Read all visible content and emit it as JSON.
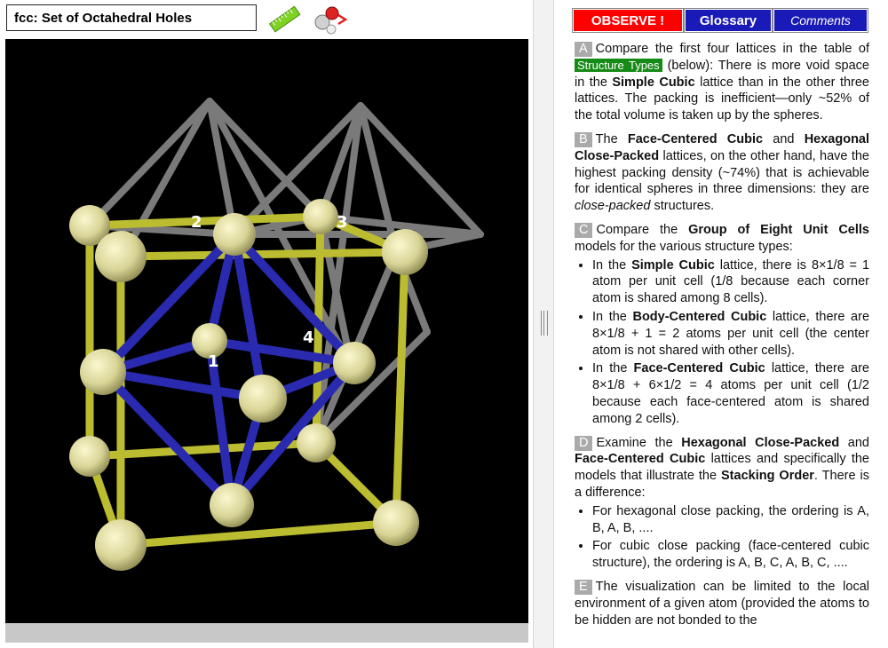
{
  "left": {
    "title": "fcc: Set of Octahedral Holes",
    "tools": {
      "ruler_icon": "ruler-icon",
      "molecule_icon": "molecule-model-icon"
    },
    "viewer": {
      "hole_labels": [
        "1",
        "2",
        "3",
        "4"
      ],
      "colors": {
        "background": "#000000",
        "cell_edges": "#c8c83a",
        "octahedron_blue": "#2a2ab4",
        "octahedron_gray": "#808080",
        "atom": "#e0dc9a"
      }
    }
  },
  "right": {
    "tabs": {
      "observe": "OBSERVE !",
      "glossary": "Glossary",
      "comments": "Comments"
    },
    "sections": {
      "A": {
        "letter": "A",
        "t1": "Compare the first four lattices in the table of",
        "link": "Structure Types",
        "t2": "(below): There is more void space in the",
        "b1": "Simple Cubic",
        "t3": "lattice than in the other three lattices. The packing is inefficient—only ~52% of the total volume is taken up by the spheres."
      },
      "B": {
        "letter": "B",
        "t1": "The",
        "b1": "Face-Centered Cubic",
        "t2": "and",
        "b2": "Hexagonal Close-Packed",
        "t3": "lattices, on the other hand, have the highest packing density (~74%) that is achievable for identical spheres in three dimensions: they are",
        "i1": "close-packed",
        "t4": "structures."
      },
      "C": {
        "letter": "C",
        "t1": "Compare the",
        "b1": "Group of Eight Unit Cells",
        "t2": "models for the various structure types:",
        "items": [
          {
            "a": "In the",
            "b": "Simple Cubic",
            "c": "lattice, there is 8×1/8 = 1 atom per unit cell (1/8 because each corner atom is shared among 8 cells)."
          },
          {
            "a": "In the",
            "b": "Body-Centered Cubic",
            "c": "lattice, there are 8×1/8 + 1 = 2 atoms per unit cell (the center atom is not shared with other cells)."
          },
          {
            "a": "In the",
            "b": "Face-Centered Cubic",
            "c": "lattice, there are 8×1/8 + 6×1/2 = 4 atoms per unit cell (1/2 because each face-centered atom is shared among 2 cells)."
          }
        ]
      },
      "D": {
        "letter": "D",
        "t1": "Examine the",
        "b1": "Hexagonal Close-Packed",
        "t2": "and",
        "b2": "Face-Centered Cubic",
        "t3": "lattices and specifically the models that illustrate the",
        "b3": "Stacking Order",
        "t4": ". There is a difference:",
        "items": [
          "For hexagonal close packing, the ordering is A, B, A, B, ....",
          "For cubic close packing (face-centered cubic structure), the ordering is A, B, C, A, B, C, ...."
        ]
      },
      "E": {
        "letter": "E",
        "t1": "The visualization can be limited to the local environment of a given atom (provided the atoms to be hidden are not bonded to the"
      }
    }
  }
}
